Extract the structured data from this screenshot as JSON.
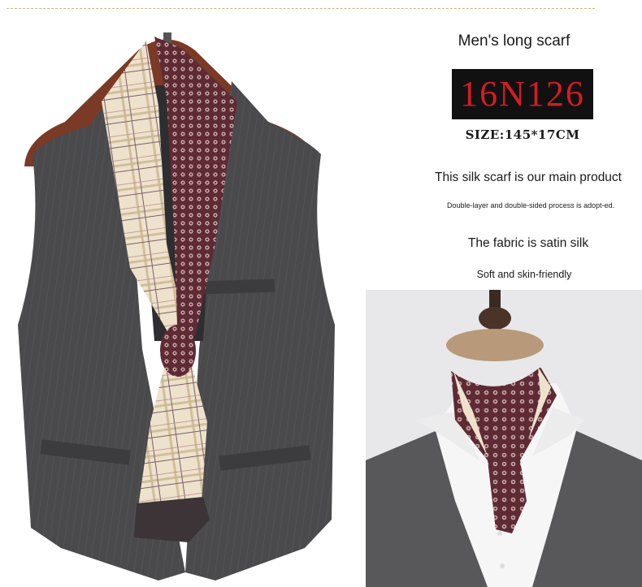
{
  "product": {
    "title": "Men's long scarf",
    "model_code": "16N126",
    "size": "SIZE:145*17CM"
  },
  "features": {
    "main": "This silk scarf is our main product",
    "process": "Double-layer and double-sided process is adopt-ed.",
    "fabric": "The fabric is satin silk",
    "feel": "Soft and skin-friendly"
  },
  "colors": {
    "code_text": "#d41c24",
    "code_background": "#111111",
    "vest": "#4a4a4c",
    "scarf_pattern": "#5e2a34",
    "plaid_base": "#eee2cc"
  }
}
